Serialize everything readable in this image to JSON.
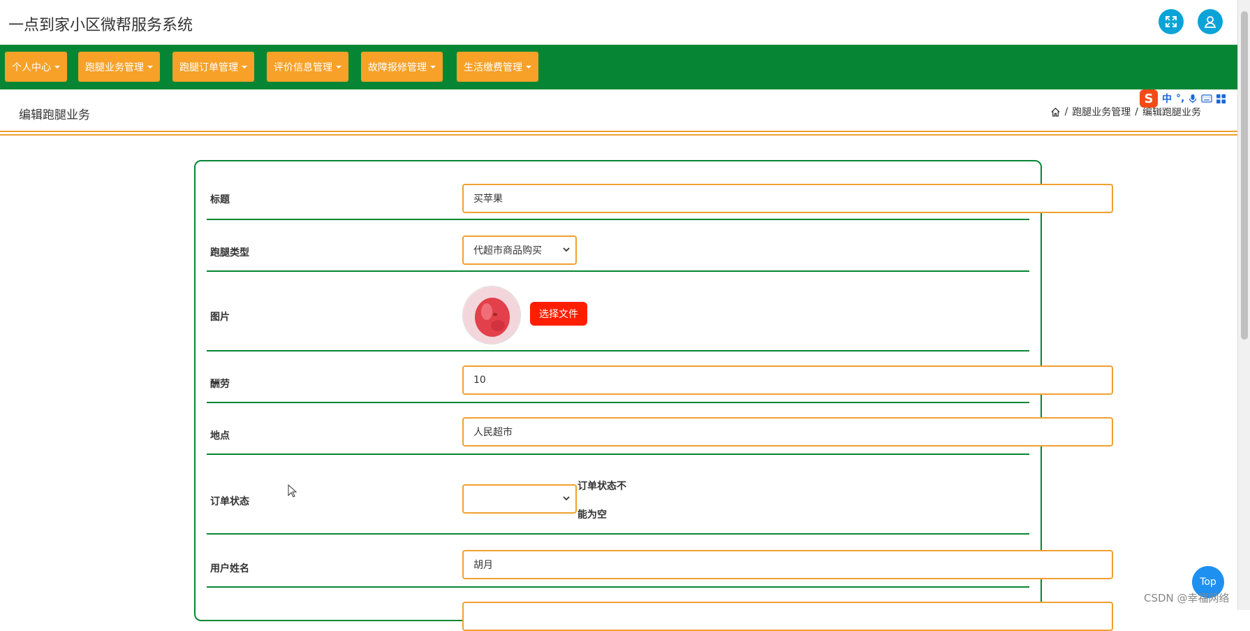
{
  "app": {
    "title": "一点到家小区微帮服务系统"
  },
  "nav": {
    "items": [
      {
        "label": "个人中心"
      },
      {
        "label": "跑腿业务管理"
      },
      {
        "label": "跑腿订单管理"
      },
      {
        "label": "评价信息管理"
      },
      {
        "label": "故障报修管理"
      },
      {
        "label": "生活缴费管理"
      }
    ]
  },
  "page": {
    "title": "编辑跑腿业务",
    "breadcrumb": {
      "parent": "跑腿业务管理",
      "separator": "/",
      "current": "编辑跑腿业务"
    }
  },
  "ime": {
    "logo": "S",
    "mode": "中",
    "punct": "°,"
  },
  "form": {
    "title": {
      "label": "标题",
      "value": "买苹果"
    },
    "type": {
      "label": "跑腿类型",
      "value": "代超市商品购买"
    },
    "image": {
      "label": "图片",
      "button": "选择文件"
    },
    "fee": {
      "label": "酬劳",
      "value": "10"
    },
    "location": {
      "label": "地点",
      "value": "人民超市"
    },
    "status": {
      "label": "订单状态",
      "value": "",
      "error_line1": "订单状态不",
      "error_line2": "能为空"
    },
    "username": {
      "label": "用户姓名",
      "value": "胡月"
    }
  },
  "top_button": {
    "label": "Top"
  },
  "watermark": "CSDN @幸福网络",
  "colors": {
    "nav_bg": "#068634",
    "button_bg": "#f7a128",
    "accent": "#0aa3d8",
    "file_button": "#ff1f00"
  }
}
